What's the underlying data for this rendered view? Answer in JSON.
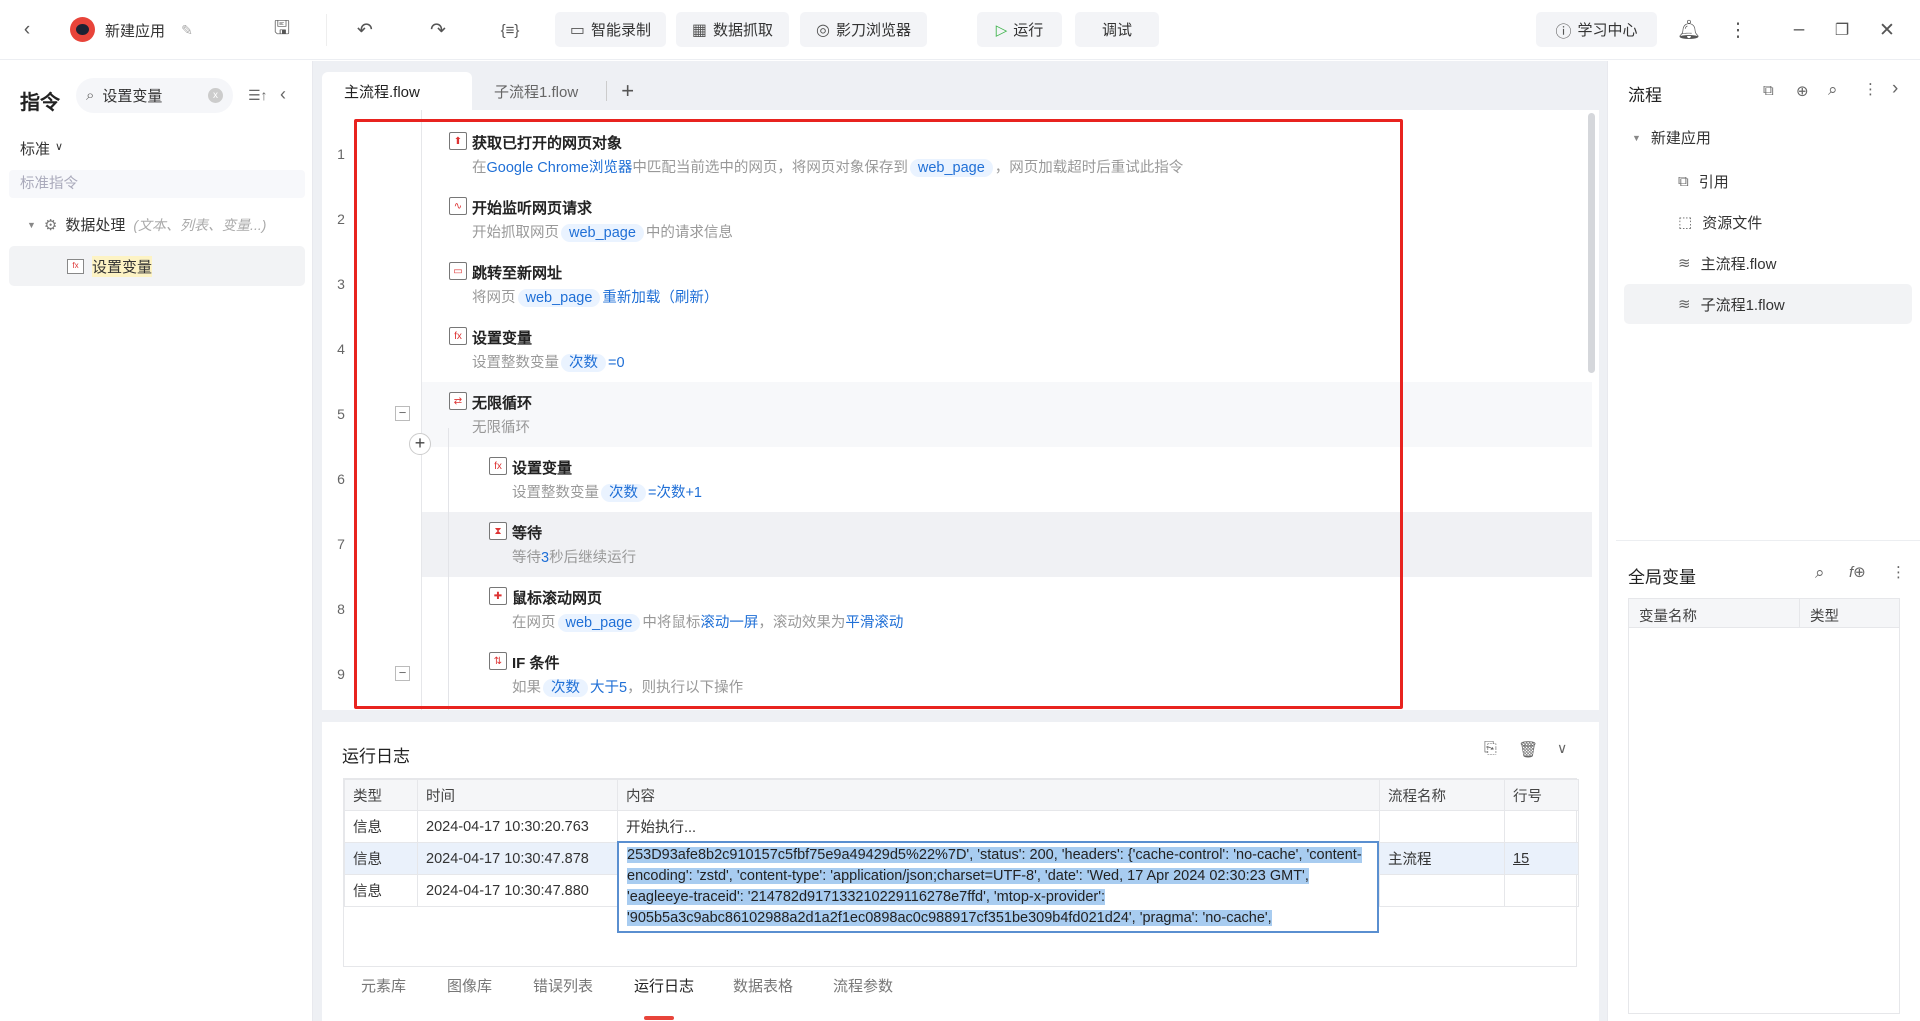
{
  "app": {
    "title": "新建应用"
  },
  "toolbar": {
    "record": "智能录制",
    "scrape": "数据抓取",
    "browser": "影刀浏览器",
    "run": "运行",
    "debug": "调试",
    "learn": "学习中心"
  },
  "colors": {
    "accent": "#1f6fd6",
    "highlight_box": "#e8231f",
    "run_icon": "#3cb34a"
  },
  "left": {
    "title": "指令",
    "search_value": "设置变量",
    "category": "标准",
    "section": "标准指令",
    "group": "数据处理",
    "group_hint": "(文本、列表、变量...)",
    "result": "设置变量"
  },
  "tabs": [
    {
      "label": "主流程.flow"
    },
    {
      "label": "子流程1.flow"
    }
  ],
  "steps": [
    {
      "n": "1",
      "indent": 0,
      "icon": "webpage-get-icon",
      "glyph": "⬆",
      "title": "获取已打开的网页对象",
      "desc": [
        {
          "t": "在"
        },
        {
          "t": "Google Chrome浏览器",
          "k": "lnk"
        },
        {
          "t": "中匹配当前选中的网页，将网页对象保存到"
        },
        {
          "t": "web_page",
          "k": "var"
        },
        {
          "t": "，网页加载超时后重试此指令"
        }
      ]
    },
    {
      "n": "2",
      "indent": 0,
      "icon": "network-listen-icon",
      "glyph": "∿",
      "title": "开始监听网页请求",
      "desc": [
        {
          "t": "开始抓取网页"
        },
        {
          "t": "web_page",
          "k": "var"
        },
        {
          "t": "中的请求信息"
        }
      ]
    },
    {
      "n": "3",
      "indent": 0,
      "icon": "navigate-url-icon",
      "glyph": "▭",
      "title": "跳转至新网址",
      "desc": [
        {
          "t": "将网页"
        },
        {
          "t": "web_page",
          "k": "var"
        },
        {
          "t": "重新加载（刷新）",
          "k": "lnk"
        }
      ]
    },
    {
      "n": "4",
      "indent": 0,
      "icon": "set-variable-icon",
      "glyph": "fx",
      "title": "设置变量",
      "desc": [
        {
          "t": "设置整数变量"
        },
        {
          "t": "次数",
          "k": "var"
        },
        {
          "t": "=0",
          "k": "lnk"
        }
      ]
    },
    {
      "n": "5",
      "indent": 0,
      "icon": "infinite-loop-icon",
      "glyph": "⇄",
      "title": "无限循环",
      "desc": [
        {
          "t": "无限循环"
        }
      ],
      "fold": true,
      "bg": "#f7f8fa"
    },
    {
      "n": "6",
      "indent": 1,
      "icon": "set-variable-icon",
      "glyph": "fx",
      "title": "设置变量",
      "desc": [
        {
          "t": "设置整数变量"
        },
        {
          "t": "次数",
          "k": "var"
        },
        {
          "t": "=次数+1",
          "k": "lnk"
        }
      ]
    },
    {
      "n": "7",
      "indent": 1,
      "icon": "hourglass-icon",
      "glyph": "⧗",
      "title": "等待",
      "desc": [
        {
          "t": "等待"
        },
        {
          "t": "3",
          "k": "lnk"
        },
        {
          "t": "秒后继续运行"
        }
      ],
      "bg": "#f0f1f4"
    },
    {
      "n": "8",
      "indent": 1,
      "icon": "mouse-scroll-icon",
      "glyph": "✚",
      "title": "鼠标滚动网页",
      "desc": [
        {
          "t": "在网页"
        },
        {
          "t": "web_page",
          "k": "var"
        },
        {
          "t": "中将鼠标"
        },
        {
          "t": "滚动一屏",
          "k": "lnk"
        },
        {
          "t": "，滚动效果为"
        },
        {
          "t": "平滑滚动",
          "k": "lnk"
        }
      ]
    },
    {
      "n": "9",
      "indent": 1,
      "icon": "if-condition-icon",
      "glyph": "⇅",
      "title": "IF 条件",
      "desc": [
        {
          "t": "如果"
        },
        {
          "t": "次数",
          "k": "var"
        },
        {
          "t": "大于5",
          "k": "lnk"
        },
        {
          "t": "，则执行以下操作"
        }
      ],
      "fold": true
    }
  ],
  "log": {
    "title": "运行日志",
    "columns": [
      "类型",
      "时间",
      "内容",
      "流程名称",
      "行号"
    ],
    "rows": [
      {
        "type": "信息",
        "time": "2024-04-17 10:30:20.763",
        "content": "开始执行...",
        "flow": "",
        "line": ""
      },
      {
        "type": "信息",
        "time": "2024-04-17 10:30:47.878",
        "content": "253D93afe8b2c910157c5fbf75e9a49429d5%22%7D', 'status': 200, 'headers': {'cache-control': 'no-cache', 'content-encoding': 'zstd', 'content-type': 'application/json;charset=UTF-8', 'date': 'Wed, 17 Apr 2024 02:30:23 GMT', 'eagleeye-traceid': '214782d917133210229116278e7ffd', 'mtop-x-provider': '905b5a3c9abc86102988a2d1a2f1ec0898ac0c988917cf351be309b4fd021d24', 'pragma': 'no-cache',",
        "flow": "主流程",
        "line": "15"
      },
      {
        "type": "信息",
        "time": "2024-04-17 10:30:47.880",
        "content": "",
        "flow": "",
        "line": ""
      }
    ]
  },
  "bottom_tabs": [
    "元素库",
    "图像库",
    "错误列表",
    "运行日志",
    "数据表格",
    "流程参数"
  ],
  "right": {
    "title": "流程",
    "tree_root": "新建应用",
    "items": [
      {
        "label": "引用",
        "icon": "reference-icon"
      },
      {
        "label": "资源文件",
        "icon": "resource-file-icon"
      },
      {
        "label": "主流程.flow",
        "icon": "layers-icon"
      },
      {
        "label": "子流程1.flow",
        "icon": "layers-icon"
      }
    ],
    "globals_title": "全局变量",
    "globals_columns": [
      "变量名称",
      "类型"
    ]
  }
}
